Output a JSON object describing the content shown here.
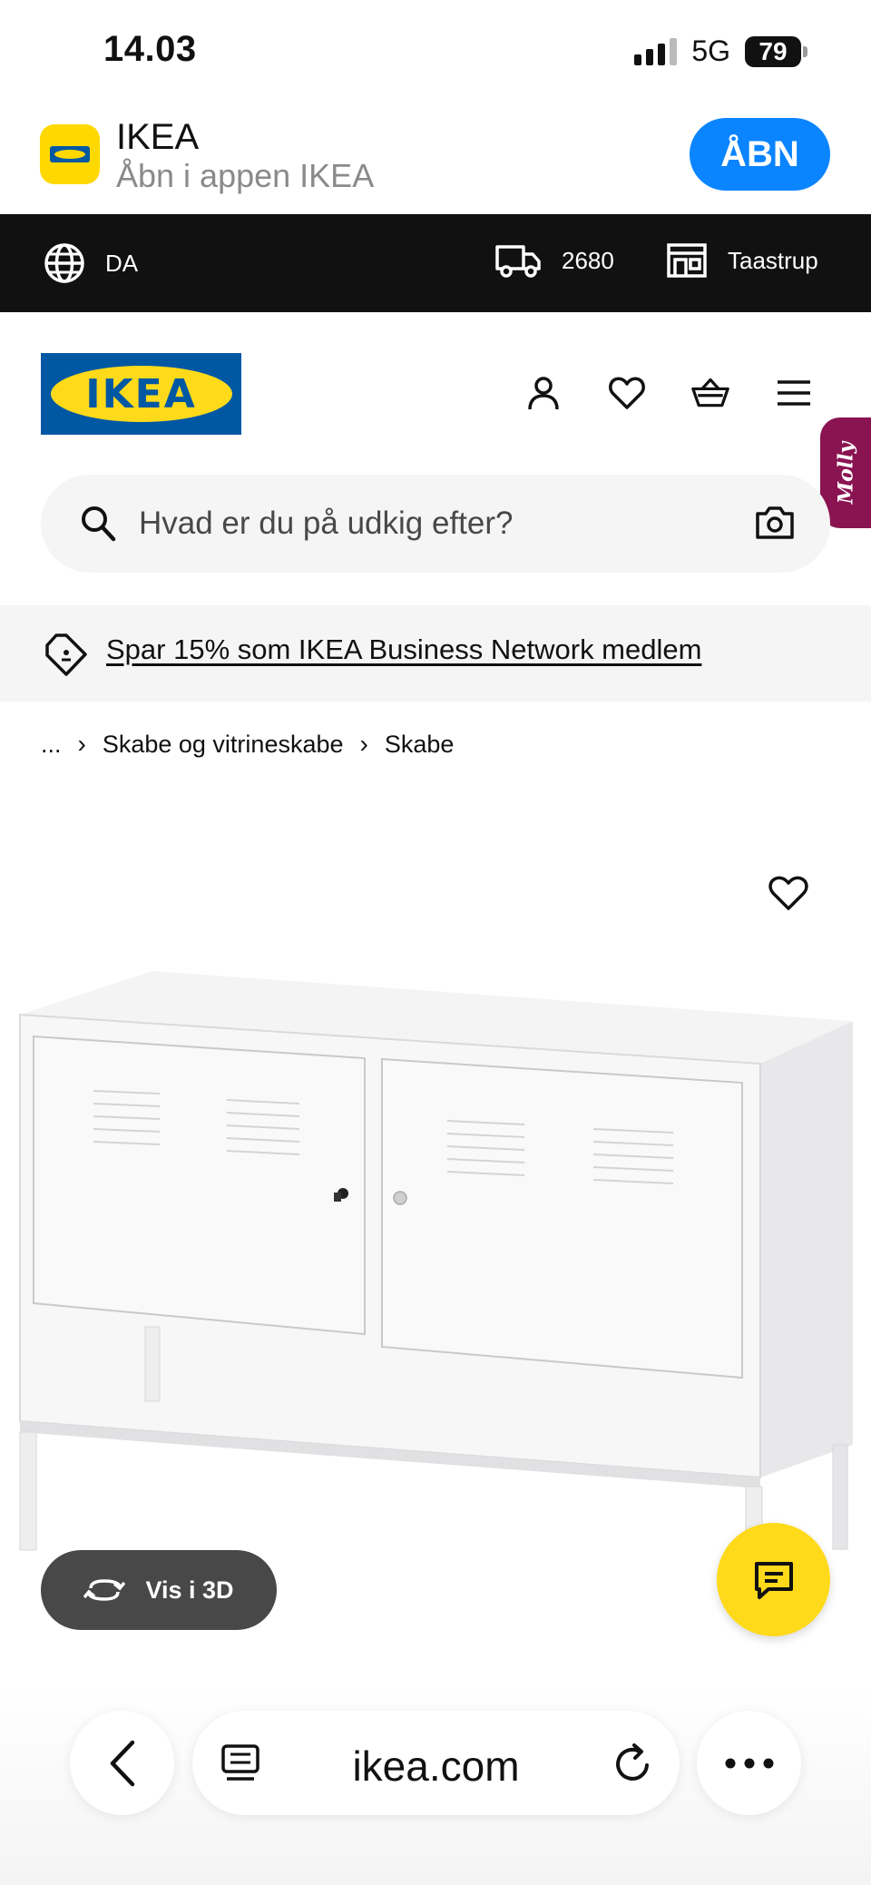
{
  "status_bar": {
    "time": "14.03",
    "network": "5G",
    "battery": "79"
  },
  "app_banner": {
    "name": "IKEA",
    "subtitle": "Åbn i appen IKEA",
    "open_label": "ÅBN",
    "icon_text": "IKEA"
  },
  "top_bar": {
    "language": "DA",
    "postal_code": "2680",
    "store": "Taastrup"
  },
  "header": {
    "logo_text": "IKEA"
  },
  "assistant_tab": {
    "label": "Molly"
  },
  "search": {
    "placeholder": "Hvad er du på udkig efter?"
  },
  "promo": {
    "text": "Spar 15% som IKEA Business Network medlem"
  },
  "breadcrumb": {
    "ellipsis": "...",
    "items": [
      "Skabe og vitrineskabe",
      "Skabe"
    ]
  },
  "product": {
    "view_3d_label": "Vis i 3D"
  },
  "browser": {
    "url": "ikea.com"
  },
  "colors": {
    "ikea_blue": "#0058A3",
    "ikea_yellow": "#FFDA1A",
    "ios_blue": "#0A84FF",
    "dark_bar": "#111111"
  }
}
